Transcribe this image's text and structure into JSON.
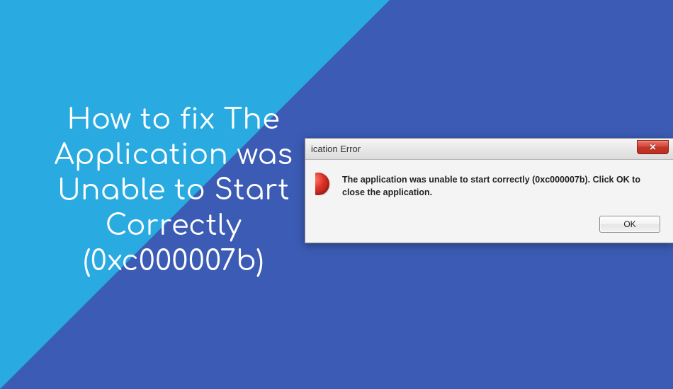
{
  "headline": "How to fix The Application was Unable to Start Correctly (0xc000007b)",
  "dialog": {
    "title_visible": "ication Error",
    "message": "The application was unable to start correctly (0xc000007b). Click OK to close the application.",
    "ok_label": "OK",
    "close_glyph": "✕"
  },
  "colors": {
    "background": "#3b5bb5",
    "triangle": "#29abe2",
    "close_button": "#c1362a"
  }
}
